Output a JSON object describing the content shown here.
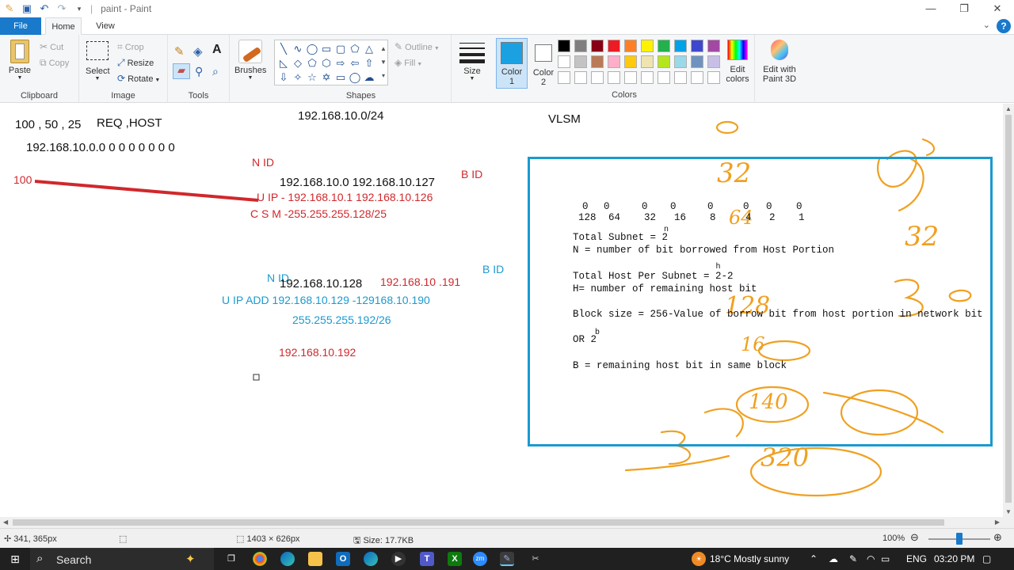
{
  "window": {
    "title": "paint - Paint",
    "minimize": "—",
    "maximize": "❐",
    "close": "✕"
  },
  "tabs": {
    "file": "File",
    "home": "Home",
    "view": "View"
  },
  "ribbon": {
    "clipboard": {
      "paste": "Paste",
      "cut": "Cut",
      "copy": "Copy",
      "label": "Clipboard"
    },
    "image": {
      "select": "Select",
      "crop": "Crop",
      "resize": "Resize",
      "rotate": "Rotate",
      "label": "Image"
    },
    "tools": {
      "label": "Tools"
    },
    "brushes": {
      "label": "Brushes"
    },
    "shapes": {
      "outline": "Outline",
      "fill": "Fill",
      "label": "Shapes"
    },
    "size": {
      "label": "Size"
    },
    "color1": {
      "label": "Color",
      "num": "1",
      "value": "#1ba1e2"
    },
    "color2": {
      "label": "Color",
      "num": "2",
      "value": "#ffffff"
    },
    "colors": {
      "label": "Colors",
      "row1": [
        "#000000",
        "#7f7f7f",
        "#880015",
        "#ed1c24",
        "#ff7f27",
        "#fff200",
        "#22b14c",
        "#00a2e8",
        "#3f48cc",
        "#a349a4"
      ],
      "row2": [
        "#ffffff",
        "#c3c3c3",
        "#b97a57",
        "#ffaec9",
        "#ffc90e",
        "#efe4b0",
        "#b5e61d",
        "#99d9ea",
        "#7092be",
        "#c8bfe7"
      ],
      "row3": [
        "#ffffff",
        "#ffffff",
        "#ffffff",
        "#ffffff",
        "#ffffff",
        "#ffffff",
        "#ffffff",
        "#ffffff",
        "#ffffff",
        "#ffffff"
      ]
    },
    "edit_colors": {
      "line1": "Edit",
      "line2": "colors"
    },
    "paint3d": {
      "line1": "Edit with",
      "line2": "Paint 3D"
    }
  },
  "canvas": {
    "req_line": "100 , 50 , 25",
    "req_host": "REQ ,HOST",
    "network": "192.168.10.0/24",
    "vlsm": "VLSM",
    "binary": "192.168.10.0.0 0 0 0 0 0 0 0",
    "red_100": "100",
    "n_id_1": "N ID",
    "subnet1_range": "192.168.10.0 192.168.10.127",
    "b_id_1": "B ID",
    "u_ip_1": "U IP - 192.168.10.1 192.168.10.126",
    "csm_1": "C S M -255.255.255.128/25",
    "n_id_2": "N ID",
    "b_id_2": "B ID",
    "subnet2_nid": "192.168.10.128",
    "subnet2_bid": "192.168.10 .191",
    "u_ip_2": "U IP ADD  192.168.10.129 -129168.10.190",
    "mask_2": "255.255.255.192/26",
    "subnet3_nid": "192.168.10.192"
  },
  "notes": {
    "bits": [
      "0",
      "0",
      "0",
      "0",
      "0",
      "0",
      "0",
      "0"
    ],
    "weights": [
      "128",
      "64",
      "32",
      "16",
      "8",
      "4",
      "2",
      "1"
    ],
    "total_subnet": "Total Subnet = 2",
    "total_subnet_exp": "n",
    "n_def": "N = number of bit borrowed from Host Portion",
    "total_host": "Total Host Per Subnet = 2-2",
    "total_host_exp": "h",
    "h_def": "H= number of remaining host bit",
    "block_size": "Block size = 256-Value of borrow bit from host portion in network bit",
    "or_line": "OR  2",
    "or_exp": "b",
    "b_def": "B = remaining host bit in same block"
  },
  "handwriting": {
    "n32a": "32",
    "n32b": "32",
    "n64": "64",
    "n128": "128",
    "n16": "16",
    "n140": "140",
    "n320": "320"
  },
  "status": {
    "cursor": "341, 365px",
    "dimensions": "1403 × 626px",
    "size": "Size: 17.7KB",
    "zoom": "100%"
  },
  "taskbar": {
    "search": "Search",
    "weather": "18°C  Mostly sunny",
    "lang": "ENG",
    "time": "03:20 PM"
  }
}
